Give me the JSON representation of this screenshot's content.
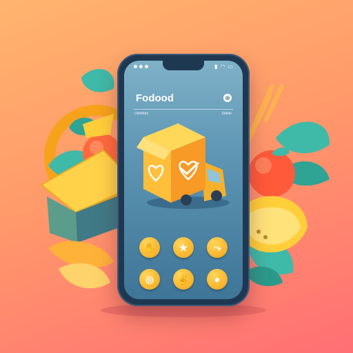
{
  "app": {
    "title": "Fodood",
    "subtitle_left": "OitriMitre",
    "subtitle_right": "Sbbtte"
  },
  "status": {
    "time": "",
    "indicators": [
      "signal-icon",
      "wifi-icon",
      "battery-icon"
    ]
  },
  "colors": {
    "background_top": "#ffb46e",
    "background_bottom": "#ff6f74",
    "phone_frame": "#1f3852",
    "screen": "#5d95b3",
    "accent_yellow": "#f6a416",
    "leaf": "#3cb4a6"
  },
  "icons": [
    {
      "name": "hand-wave-icon",
      "glyph": "✋"
    },
    {
      "name": "star-icon",
      "glyph": "★"
    },
    {
      "name": "share-icon",
      "glyph": "⤳"
    },
    {
      "name": "target-icon",
      "glyph": "◎"
    },
    {
      "name": "hands-icon",
      "glyph": "✌"
    },
    {
      "name": "cookie-icon",
      "glyph": "●"
    }
  ]
}
